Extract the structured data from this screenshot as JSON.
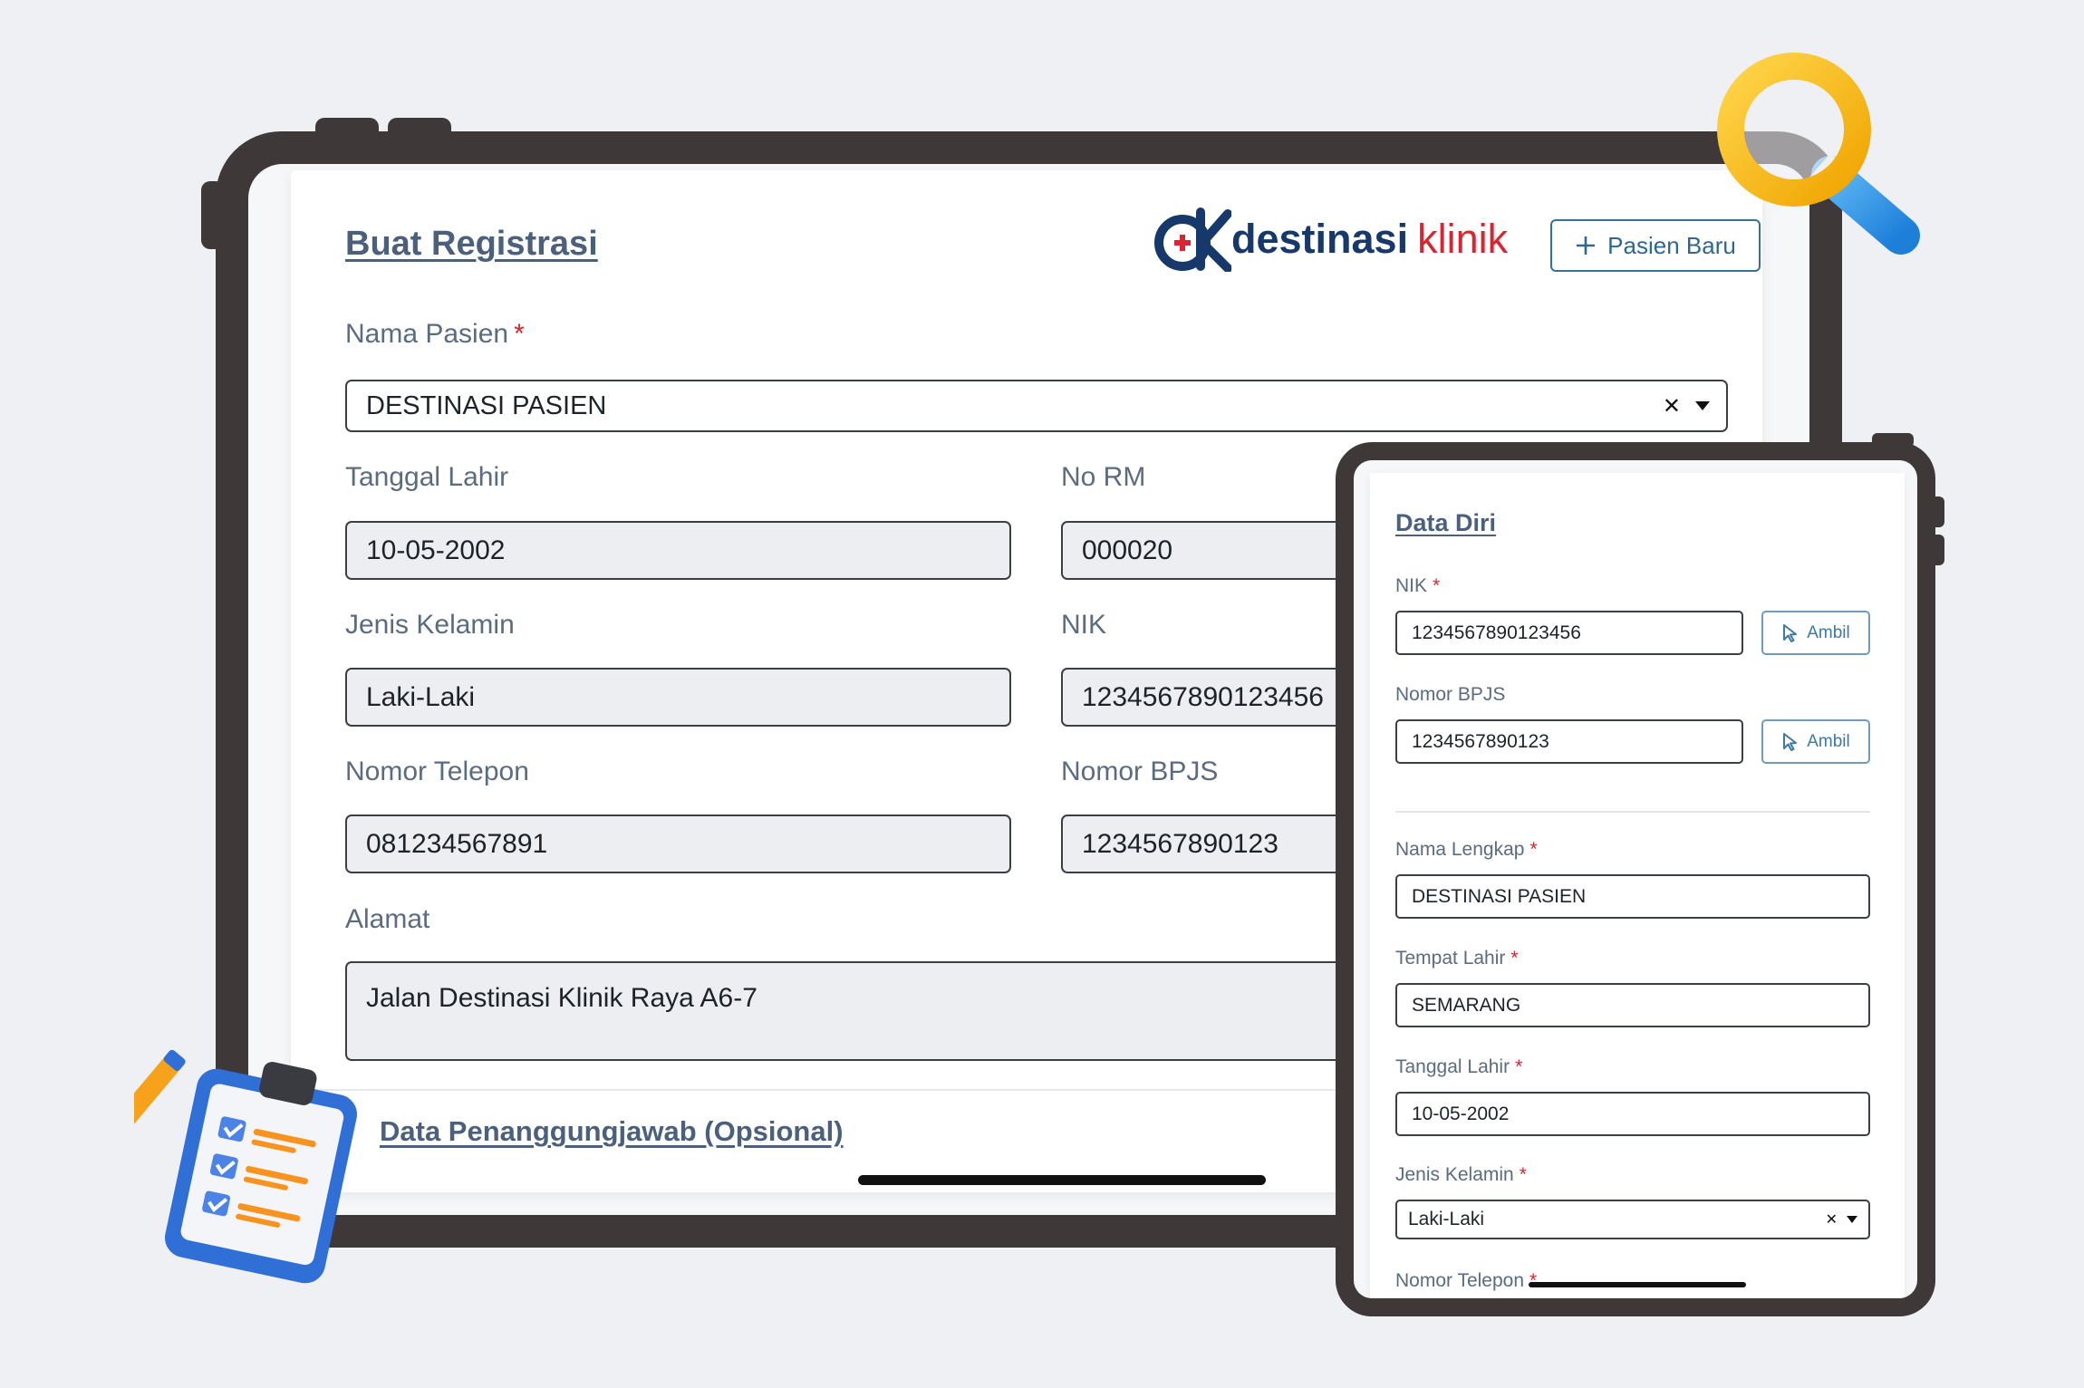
{
  "brand": {
    "logo_main": "destinasi",
    "logo_accent": "klinik",
    "colors": {
      "navy": "#17386b",
      "red": "#d92533",
      "link": "#4a607c",
      "frame": "#3f3839"
    }
  },
  "main_form": {
    "title": "Buat Registrasi",
    "new_patient_label": "Pasien Baru",
    "patient_name": {
      "label": "Nama Pasien",
      "required_mark": "*",
      "value": "DESTINASI PASIEN"
    },
    "birth_date": {
      "label": "Tanggal Lahir",
      "value": "10-05-2002"
    },
    "medical_record": {
      "label": "No RM",
      "value": "000020"
    },
    "gender": {
      "label": "Jenis Kelamin",
      "value": "Laki-Laki"
    },
    "nik": {
      "label": "NIK",
      "value": "1234567890123456"
    },
    "phone": {
      "label": "Nomor Telepon",
      "value": "081234567891"
    },
    "bpjs": {
      "label": "Nomor BPJS",
      "value": "1234567890123"
    },
    "address": {
      "label": "Alamat",
      "value": "Jalan Destinasi Klinik Raya A6-7"
    },
    "guarantor_link": "Data Penanggungjawab (Opsional)"
  },
  "side_form": {
    "title": "Data Diri",
    "ambil_label": "Ambil",
    "nik": {
      "label": "NIK",
      "required_mark": "*",
      "value": "1234567890123456"
    },
    "bpjs": {
      "label": "Nomor BPJS",
      "value": "1234567890123"
    },
    "full_name": {
      "label": "Nama Lengkap",
      "required_mark": "*",
      "value": "DESTINASI PASIEN"
    },
    "birth_place": {
      "label": "Tempat Lahir",
      "required_mark": "*",
      "value": "SEMARANG"
    },
    "birth_date": {
      "label": "Tanggal Lahir",
      "required_mark": "*",
      "value": "10-05-2002"
    },
    "gender": {
      "label": "Jenis Kelamin",
      "required_mark": "*",
      "value": "Laki-Laki"
    },
    "phone": {
      "label": "Nomor Telepon",
      "required_mark": "*"
    }
  },
  "icons": {
    "plus": "plus-icon",
    "clear": "close-icon",
    "caret": "chevron-down-icon",
    "cursor": "cursor-icon",
    "magnifier": "magnifier-icon",
    "clipboard": "clipboard-checklist-icon"
  }
}
